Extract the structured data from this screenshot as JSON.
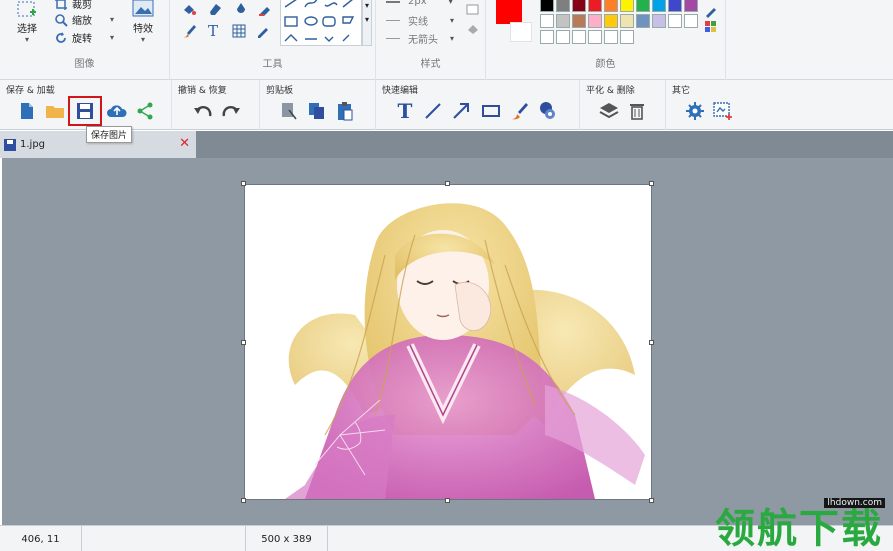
{
  "ribbon": {
    "groups": [
      {
        "label": "图像"
      },
      {
        "label": "工具"
      },
      {
        "label": "样式"
      },
      {
        "label": "颜色"
      }
    ],
    "select_label": "选择",
    "crop_label": "裁剪",
    "resize_label": "缩放",
    "rotate_label": "旋转",
    "effects_label": "特效",
    "line_width_label": "2px",
    "line_style_label": "实线",
    "arrow_label": "无箭头"
  },
  "colors": {
    "primary": "#ff0000",
    "secondary": "#ffffff",
    "palette": [
      "#000000",
      "#7f7f7f",
      "#880015",
      "#ed1c24",
      "#ff7f27",
      "#fff200",
      "#22b14c",
      "#00a2e8",
      "#ffffff",
      "#c3c3c3",
      "#b97a57",
      "#ffaec9",
      "#ffc90e",
      "#efe4b0",
      "#b5e61d",
      "#99d9ea",
      "#ffffff",
      "#ffffff",
      "#ffffff",
      "#ffffff",
      "#ffffff",
      "#ffffff",
      "#ffffff",
      "#ffffff"
    ],
    "palette_extra": [
      "#3f48cc",
      "#a349a4",
      "#7092be",
      "#c8bfe7",
      "#ffffff"
    ]
  },
  "toolbar": {
    "groups": [
      {
        "label": "保存 & 加载"
      },
      {
        "label": "撤销 & 恢复"
      },
      {
        "label": "剪贴板"
      },
      {
        "label": "快速编辑"
      },
      {
        "label": "平化 & 删除"
      },
      {
        "label": "其它"
      }
    ],
    "tooltip": "保存图片"
  },
  "tab": {
    "name": "1.jpg"
  },
  "status": {
    "cursor": "406, 11",
    "selection": "",
    "image_size": "500 x 389"
  },
  "watermark": {
    "text": "领航下载",
    "url": "lhdown.com"
  }
}
